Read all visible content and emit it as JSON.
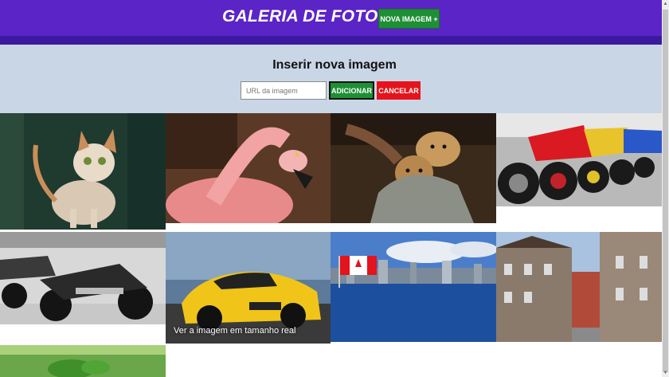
{
  "header": {
    "title": "GALERIA DE FOTOS",
    "new_image_button": "NOVA IMAGEM +"
  },
  "insert_form": {
    "title": "Inserir nova imagem",
    "url_placeholder": "URL da imagem",
    "add_button": "ADICIONAR",
    "cancel_button": "CANCELAR"
  },
  "gallery": {
    "hover_caption": "Ver a imagem em tamanho real",
    "images": [
      "cat",
      "flamingo",
      "puppy",
      "motorcycles-row",
      "motorcycles-parked",
      "yellow-mustang",
      "canada-skyline",
      "old-street",
      "plant-sprout"
    ]
  },
  "colors": {
    "header_bg": "#5b24c7",
    "header_strip": "#3c1aa0",
    "panel_bg": "#c9d6e6",
    "add_green": "#1e8f35",
    "cancel_red": "#e5141c"
  }
}
